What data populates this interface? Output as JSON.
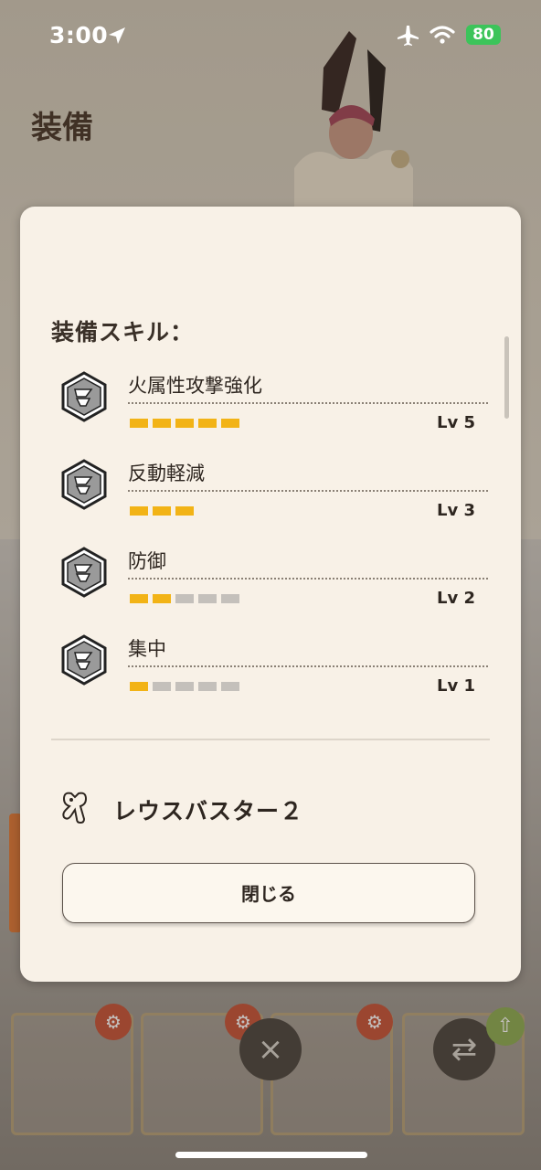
{
  "status_bar": {
    "time": "3:00",
    "battery": "80"
  },
  "page": {
    "title": "装備"
  },
  "modal": {
    "skills_heading": "装備スキル：",
    "skills": [
      {
        "name": "火属性攻撃強化",
        "level_label": "Lv 5",
        "level": 5,
        "max_level": 5
      },
      {
        "name": "反動軽減",
        "level_label": "Lv 3",
        "level": 3,
        "max_level": 3
      },
      {
        "name": "防御",
        "level_label": "Lv 2",
        "level": 2,
        "max_level": 5
      },
      {
        "name": "集中",
        "level_label": "Lv 1",
        "level": 1,
        "max_level": 5
      }
    ],
    "weapon_name": "レウスバスター２",
    "close_label": "閉じる"
  },
  "colors": {
    "bar_filled": "#f2b316",
    "bar_empty": "#c4c0bb",
    "modal_bg": "#f8f1e7",
    "battery": "#3cc45a"
  },
  "icons": {
    "skill": "skill-hexagon-icon",
    "weapon": "weapon-type-icon",
    "cancel": "close-x-icon",
    "swap": "swap-arrows-icon",
    "upgrade": "arrow-up-icon"
  }
}
